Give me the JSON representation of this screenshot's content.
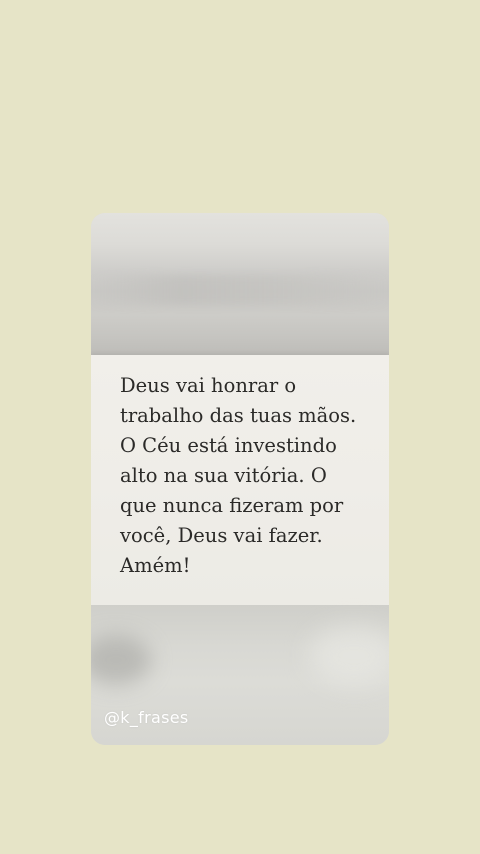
{
  "quote": {
    "text": "Deus vai honrar o\ntrabalho das tuas mãos.\nO Céu está investindo\nalto na sua vitória. O\nque nunca fizeram por\nvocê, Deus vai fazer.\nAmém!"
  },
  "watermark": {
    "handle": "@k_frases"
  },
  "colors": {
    "background": "#e6e4c7",
    "paper": "#efede8",
    "text": "#2b2a28"
  }
}
